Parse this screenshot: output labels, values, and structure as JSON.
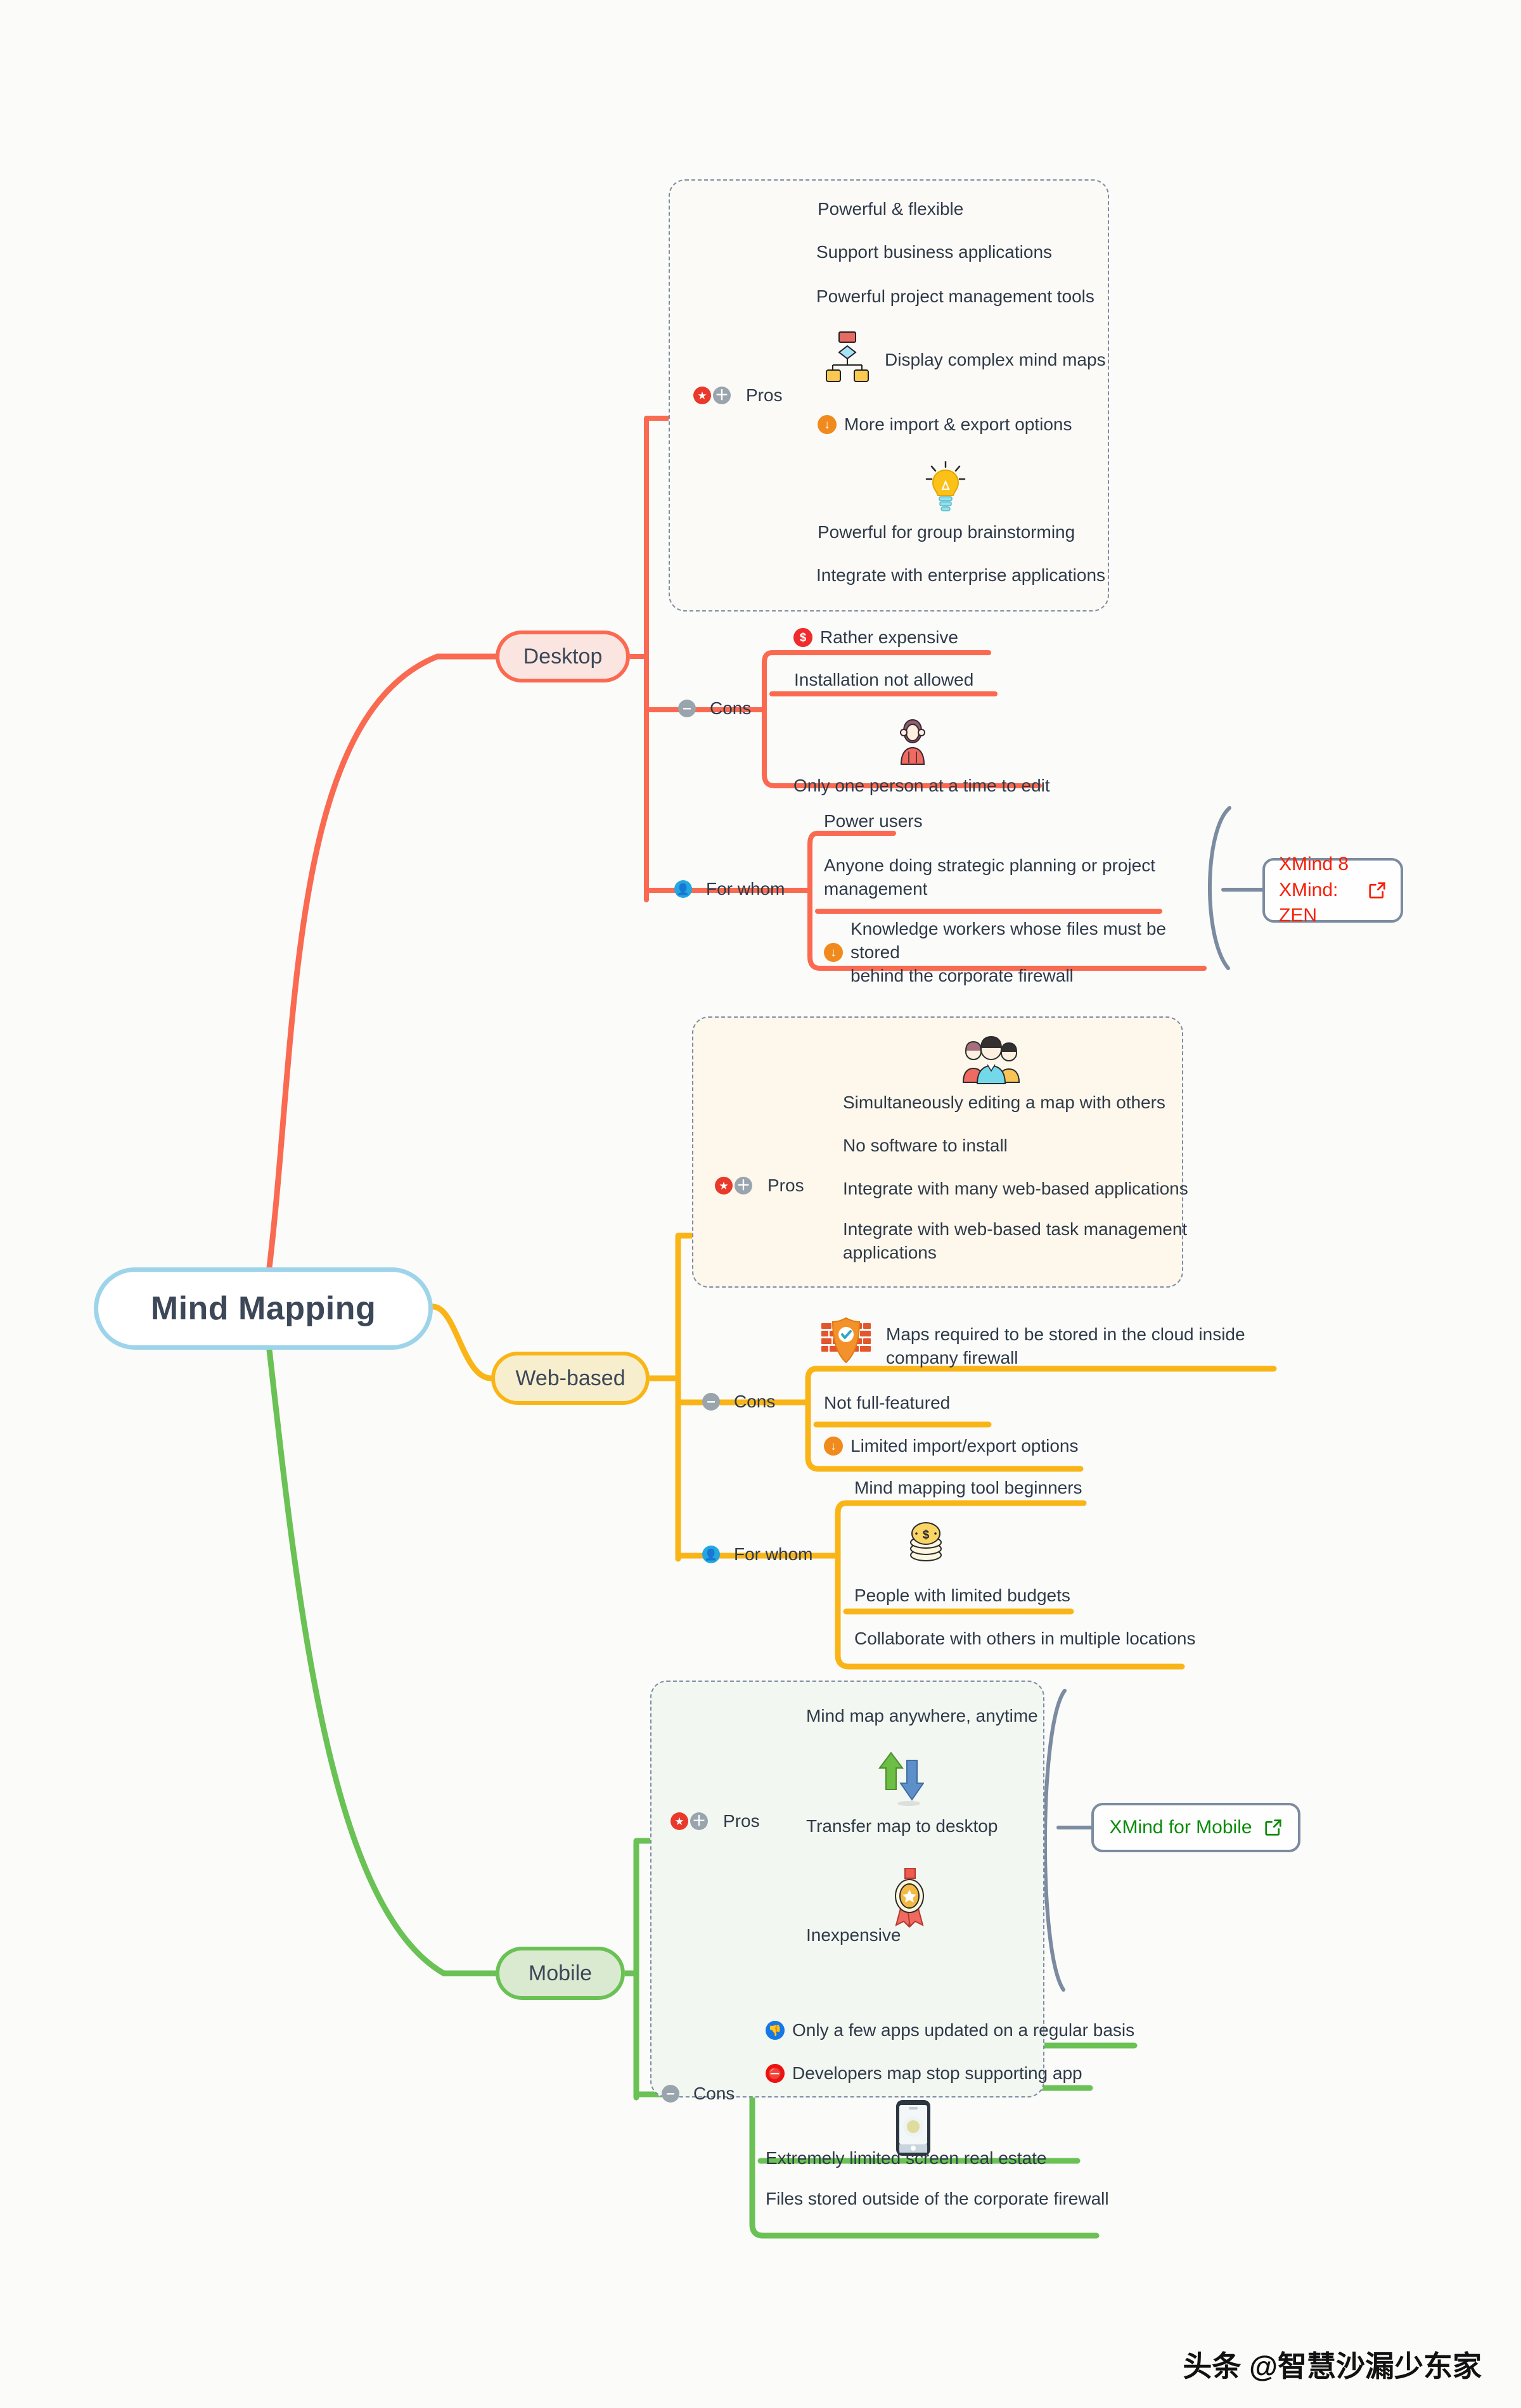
{
  "root": {
    "label": "Mind Mapping"
  },
  "branches": [
    {
      "id": "desktop",
      "label": "Desktop",
      "color": "#fa6a51",
      "groups": [
        {
          "id": "desktop-pros",
          "label": "Pros",
          "marker": "star-plus",
          "items": [
            {
              "text": "Powerful & flexible"
            },
            {
              "text": "Support business applications"
            },
            {
              "text": "Powerful project management tools"
            },
            {
              "text": "Display complex mind maps",
              "image": "org-chart"
            },
            {
              "text": "More import & export options",
              "marker": "orange-down-arrow"
            },
            {
              "text": "Powerful for group brainstorming",
              "image": "lightbulb"
            },
            {
              "text": "Integrate with enterprise applications"
            }
          ]
        },
        {
          "id": "desktop-cons",
          "label": "Cons",
          "marker": "minus",
          "items": [
            {
              "text": "Rather expensive",
              "marker": "red-dollar"
            },
            {
              "text": "Installation not allowed"
            },
            {
              "text": "Only one person at a time to edit",
              "image": "single-person"
            }
          ]
        },
        {
          "id": "desktop-forwhom",
          "label": "For whom",
          "marker": "user",
          "items": [
            {
              "text": "Power users"
            },
            {
              "text": "Anyone doing strategic planning or project\nmanagement"
            },
            {
              "text": "Knowledge workers whose files must be stored\nbehind the corporate firewall",
              "marker": "orange-down-arrow"
            }
          ]
        }
      ],
      "summary": {
        "text": "XMind 8\nXMind: ZEN",
        "color": "#f91d08",
        "icon": "external-link-icon"
      }
    },
    {
      "id": "web",
      "label": "Web-based",
      "color": "#f9b517",
      "groups": [
        {
          "id": "web-pros",
          "label": "Pros",
          "marker": "star-plus",
          "items": [
            {
              "text": "Simultaneously editing a map with others",
              "image": "team-group"
            },
            {
              "text": "No software to install"
            },
            {
              "text": "Integrate with many web-based applications"
            },
            {
              "text": "Integrate with web-based task management\napplications"
            }
          ]
        },
        {
          "id": "web-cons",
          "label": "Cons",
          "marker": "minus",
          "items": [
            {
              "text": "Maps required to be stored in the cloud inside\ncompany firewall",
              "image": "firewall-shield"
            },
            {
              "text": "Not full-featured"
            },
            {
              "text": "Limited import/export options",
              "marker": "orange-down-arrow"
            }
          ]
        },
        {
          "id": "web-forwhom",
          "label": "For whom",
          "marker": "user",
          "items": [
            {
              "text": "Mind mapping tool beginners"
            },
            {
              "text": "People with limited budgets",
              "image": "coins"
            },
            {
              "text": "Collaborate with others in multiple locations"
            }
          ]
        }
      ]
    },
    {
      "id": "mobile",
      "label": "Mobile",
      "color": "#6ac154",
      "groups": [
        {
          "id": "mobile-pros",
          "label": "Pros",
          "marker": "star-plus",
          "items": [
            {
              "text": "Mind map anywhere, anytime"
            },
            {
              "text": "Transfer map to desktop",
              "image": "transfer-arrows"
            },
            {
              "text": "Inexpensive",
              "image": "award-medal"
            }
          ]
        },
        {
          "id": "mobile-cons",
          "label": "Cons",
          "marker": "minus",
          "items": [
            {
              "text": "Only a few apps updated on a regular basis",
              "marker": "blue-thumbs-down"
            },
            {
              "text": "Developers map stop supporting app",
              "marker": "red-stop"
            },
            {
              "text": "Extremely limited screen real estate",
              "image": "smartphone"
            },
            {
              "text": "Files stored outside of the corporate firewall"
            }
          ]
        }
      ],
      "summary": {
        "text": "XMind for Mobile",
        "color": "#0a8b0a",
        "icon": "external-link-icon"
      }
    }
  ],
  "watermark": {
    "text": "头条 @智慧沙漏少东家"
  }
}
